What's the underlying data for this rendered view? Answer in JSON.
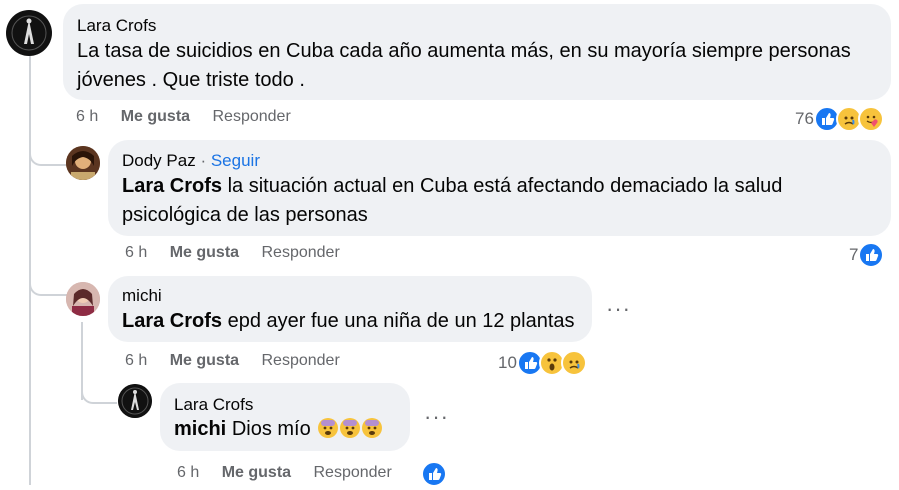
{
  "comments": [
    {
      "author": "Lara Crofs",
      "text": "La tasa de suicidios en Cuba cada año aumenta más, en su mayoría siempre personas",
      "text2": "jóvenes . Que triste todo .",
      "time": "6 h",
      "like_label": "Me gusta",
      "reply_label": "Responder",
      "reaction_count": "76",
      "reactions": [
        "like-icon",
        "sad-icon",
        "care-icon"
      ]
    },
    {
      "author": "Dody Paz",
      "separator": "·",
      "follow_label": "Seguir",
      "mention": "Lara Crofs",
      "text": "la situación actual en Cuba está afectando demaciado la salud",
      "text2": "psicológica de las personas",
      "time": "6 h",
      "like_label": "Me gusta",
      "reply_label": "Responder",
      "reaction_count": "7",
      "reactions": [
        "like-icon"
      ]
    },
    {
      "author": "michi",
      "mention": "Lara Crofs",
      "text": "epd ayer fue una niña de un 12 plantas",
      "time": "6 h",
      "like_label": "Me gusta",
      "reply_label": "Responder",
      "reaction_count": "10",
      "reactions": [
        "like-icon",
        "wow-icon",
        "sad-icon"
      ],
      "more_label": "···"
    },
    {
      "author": "Lara Crofs",
      "mention": "michi",
      "text": "Dios mío",
      "text_emojis": [
        "fearful-face-icon",
        "fearful-face-icon",
        "fearful-face-icon"
      ],
      "time": "6 h",
      "like_label": "Me gusta",
      "reply_label": "Responder",
      "reactions": [
        "like-icon"
      ],
      "more_label": "···"
    }
  ],
  "colors": {
    "bubble": "#eff1f4",
    "link": "#1b74e4",
    "meta": "#65676b",
    "like": "#1877f2"
  }
}
